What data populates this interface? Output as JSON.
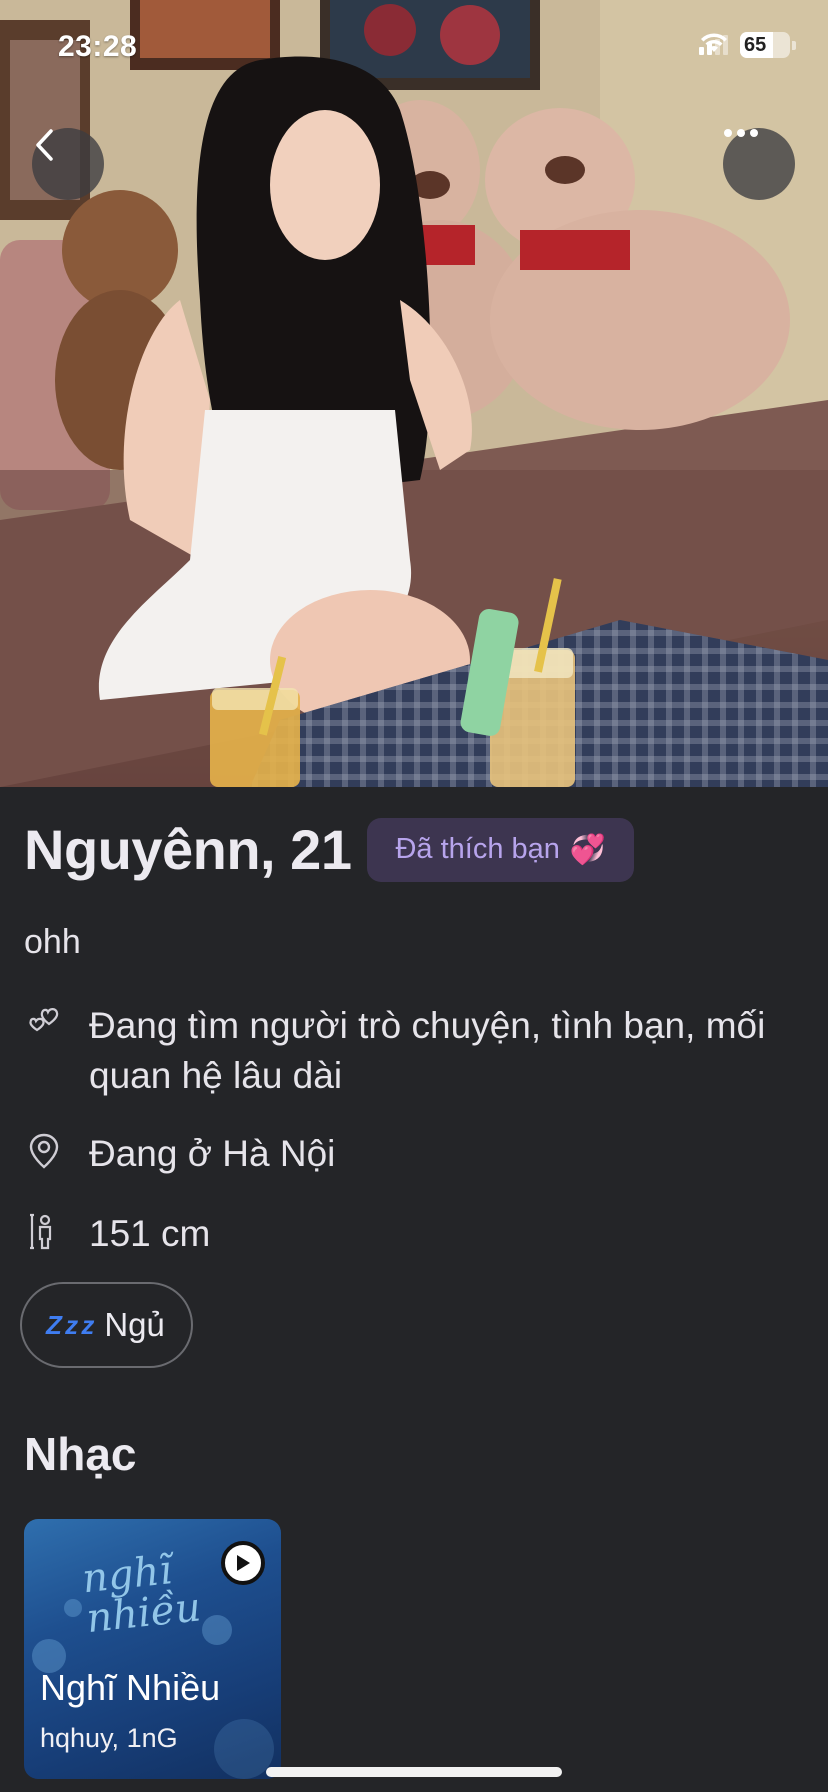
{
  "status_bar": {
    "time": "23:28",
    "battery": "65"
  },
  "photo": {
    "description_icon": "profile-photo"
  },
  "profile": {
    "name_age": "Nguyênn, 21",
    "liked_badge": "Đã thích bạn",
    "liked_emoji": "💞",
    "bio": "ohh",
    "looking_for": "Đang tìm người trò chuyện, tình bạn, mối quan hệ lâu dài",
    "location": "Đang ở Hà Nội",
    "height": "151 cm",
    "chip_icon": "Z z z",
    "chip_label": "Ngủ"
  },
  "music": {
    "section_title": "Nhạc",
    "card": {
      "art_text": "nghĩ nhiều",
      "song": "Nghĩ Nhiều",
      "artist": "hqhuy, 1nG"
    }
  },
  "colors": {
    "background": "#242528",
    "badge_bg": "#3d3550",
    "badge_text": "#b7a4ec",
    "zzz_blue": "#3f7df1"
  }
}
